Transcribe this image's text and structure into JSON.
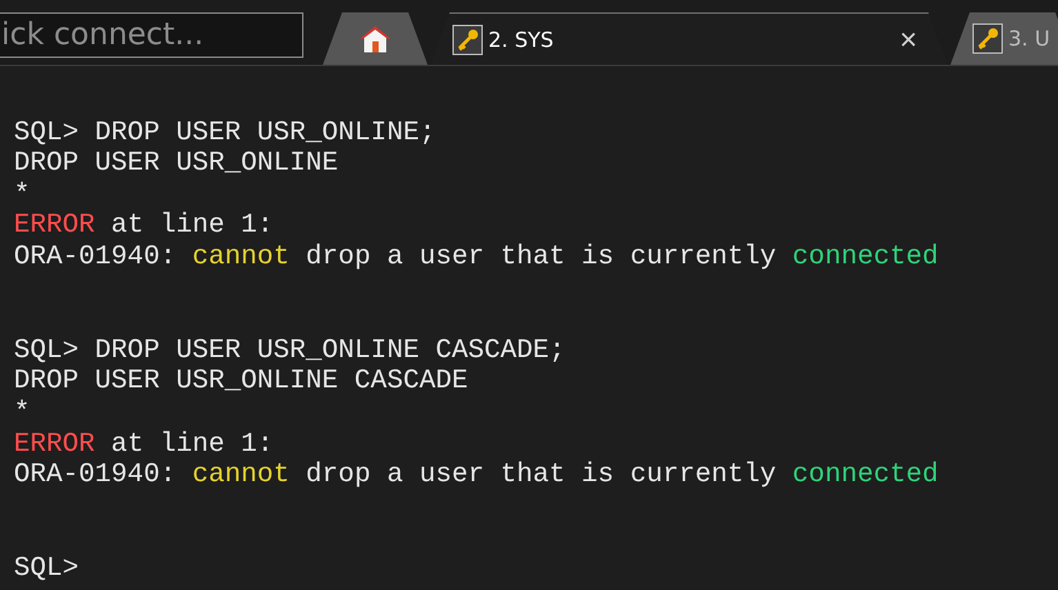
{
  "quick_connect": {
    "placeholder": "ick connect..."
  },
  "tabs": [
    {
      "kind": "home",
      "selected": false
    },
    {
      "kind": "session",
      "label": "2. SYS",
      "selected": true,
      "close": "×"
    },
    {
      "kind": "session",
      "label": "3. U",
      "selected": false
    }
  ],
  "terminal": {
    "lines": [
      {
        "kind": "blank"
      },
      {
        "kind": "text",
        "segments": [
          {
            "kind": "plain",
            "text": "SQL> DROP USER USR_ONLINE;"
          }
        ]
      },
      {
        "kind": "text",
        "segments": [
          {
            "kind": "plain",
            "text": "DROP USER USR_ONLINE"
          }
        ]
      },
      {
        "kind": "text",
        "segments": [
          {
            "kind": "plain",
            "text": "*"
          }
        ]
      },
      {
        "kind": "text",
        "segments": [
          {
            "kind": "error",
            "text": "ERROR"
          },
          {
            "kind": "plain",
            "text": " at line 1:"
          }
        ]
      },
      {
        "kind": "text",
        "segments": [
          {
            "kind": "plain",
            "text": "ORA-01940: "
          },
          {
            "kind": "warn",
            "text": "cannot"
          },
          {
            "kind": "plain",
            "text": " drop a user that is currently "
          },
          {
            "kind": "good",
            "text": "connected"
          }
        ]
      },
      {
        "kind": "blank"
      },
      {
        "kind": "blank"
      },
      {
        "kind": "text",
        "segments": [
          {
            "kind": "plain",
            "text": "SQL> DROP USER USR_ONLINE CASCADE;"
          }
        ]
      },
      {
        "kind": "text",
        "segments": [
          {
            "kind": "plain",
            "text": "DROP USER USR_ONLINE CASCADE"
          }
        ]
      },
      {
        "kind": "text",
        "segments": [
          {
            "kind": "plain",
            "text": "*"
          }
        ]
      },
      {
        "kind": "text",
        "segments": [
          {
            "kind": "error",
            "text": "ERROR"
          },
          {
            "kind": "plain",
            "text": " at line 1:"
          }
        ]
      },
      {
        "kind": "text",
        "segments": [
          {
            "kind": "plain",
            "text": "ORA-01940: "
          },
          {
            "kind": "warn",
            "text": "cannot"
          },
          {
            "kind": "plain",
            "text": " drop a user that is currently "
          },
          {
            "kind": "good",
            "text": "connected"
          }
        ]
      },
      {
        "kind": "blank"
      },
      {
        "kind": "blank"
      },
      {
        "kind": "text",
        "segments": [
          {
            "kind": "plain",
            "text": "SQL>"
          }
        ]
      }
    ]
  }
}
